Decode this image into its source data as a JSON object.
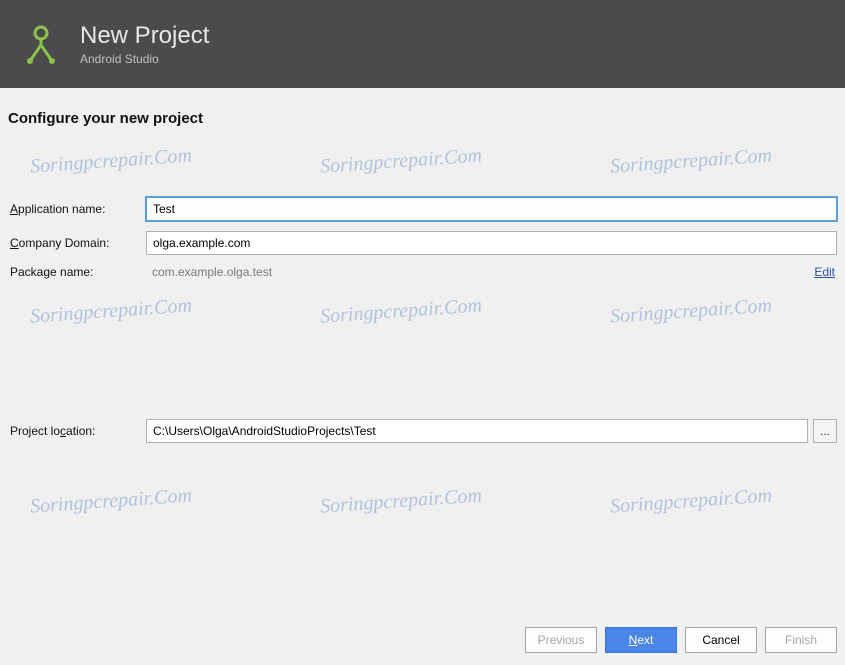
{
  "header": {
    "title": "New Project",
    "subtitle": "Android Studio"
  },
  "section_title": "Configure your new project",
  "form": {
    "app_name_label": "Application name:",
    "app_name_value": "Test",
    "company_domain_label": "Company Domain:",
    "company_domain_value": "olga.example.com",
    "package_name_label": "Package name:",
    "package_name_value": "com.example.olga.test",
    "edit_label": "Edit",
    "project_location_label": "Project location:",
    "project_location_value": "C:\\Users\\Olga\\AndroidStudioProjects\\Test",
    "browse_label": "..."
  },
  "footer": {
    "previous": "Previous",
    "next": "Next",
    "cancel": "Cancel",
    "finish": "Finish"
  },
  "watermark_text": "Soringpcrepair.Com"
}
